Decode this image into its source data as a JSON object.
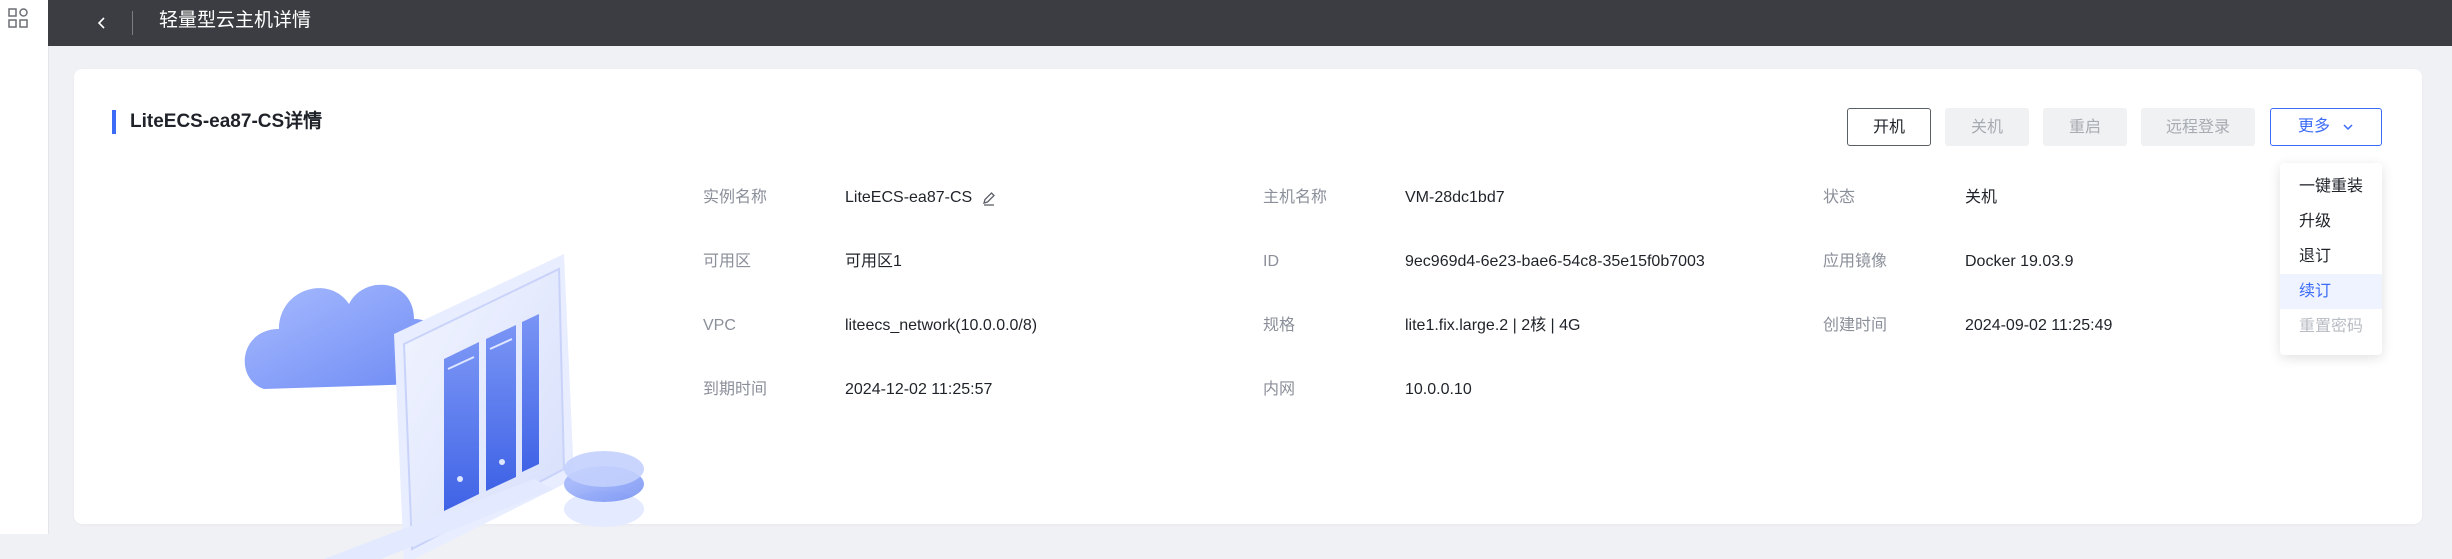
{
  "header": {
    "title": "轻量型云主机详情"
  },
  "card": {
    "title": "LiteECS-ea87-CS详情"
  },
  "actions": {
    "power_on": "开机",
    "power_off": "关机",
    "restart": "重启",
    "remote_login": "远程登录",
    "more": "更多"
  },
  "more_menu": {
    "items": [
      {
        "label": "一键重装",
        "state": "normal"
      },
      {
        "label": "升级",
        "state": "normal"
      },
      {
        "label": "退订",
        "state": "normal"
      },
      {
        "label": "续订",
        "state": "hover"
      },
      {
        "label": "重置密码",
        "state": "disabled"
      }
    ]
  },
  "info": {
    "instance_name": {
      "label": "实例名称",
      "value": "LiteECS-ea87-CS"
    },
    "host_name": {
      "label": "主机名称",
      "value": "VM-28dc1bd7"
    },
    "status": {
      "label": "状态",
      "value": "关机"
    },
    "zone": {
      "label": "可用区",
      "value": "可用区1"
    },
    "id": {
      "label": "ID",
      "value": "9ec969d4-6e23-bae6-54c8-35e15f0b7003"
    },
    "image": {
      "label": "应用镜像",
      "value": "Docker 19.03.9"
    },
    "vpc": {
      "label": "VPC",
      "value": "liteecs_network(10.0.0.0/8)"
    },
    "spec": {
      "label": "规格",
      "value": "lite1.fix.large.2 | 2核 | 4G"
    },
    "created": {
      "label": "创建时间",
      "value": "2024-09-02 11:25:49"
    },
    "expire": {
      "label": "到期时间",
      "value": "2024-12-02 11:25:57"
    },
    "private_ip": {
      "label": "内网",
      "value": "10.0.0.10"
    }
  },
  "colors": {
    "accent": "#3c6cf6",
    "header_bg": "#3c3d42",
    "page_bg": "#f0f1f4"
  },
  "icons": [
    "apps-icon",
    "chevron-left-icon",
    "edit-icon",
    "chevron-down-icon",
    "server-illustration"
  ]
}
